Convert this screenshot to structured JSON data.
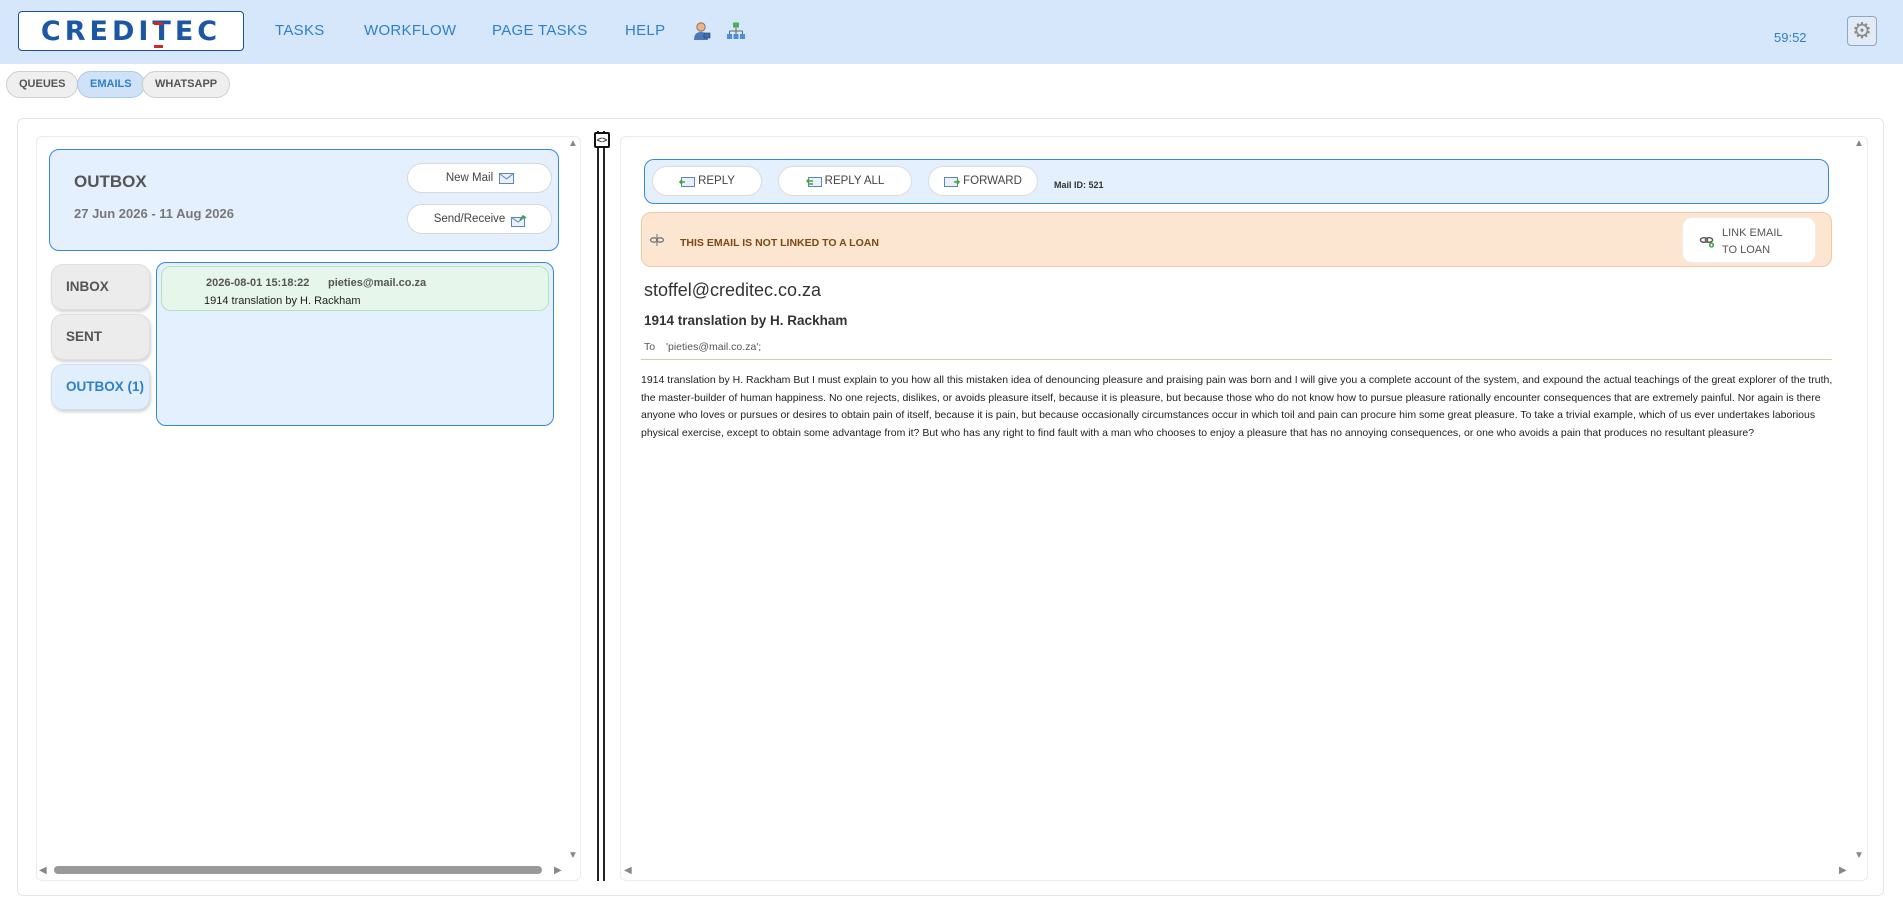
{
  "header": {
    "logo_text": "CREDITEC",
    "nav": [
      "TASKS",
      "WORKFLOW",
      "PAGE TASKS",
      "HELP"
    ],
    "timer": "59:52",
    "icons": [
      "user-icon",
      "org-chart-icon",
      "gear-icon"
    ]
  },
  "tabs": [
    {
      "label": "QUEUES",
      "active": false
    },
    {
      "label": "EMAILS",
      "active": true
    },
    {
      "label": "WHATSAPP",
      "active": false
    }
  ],
  "outbox": {
    "title": "OUTBOX",
    "date_range": "27 Jun 2026 - 11 Aug 2026",
    "new_mail_label": "New Mail",
    "send_receive_label": "Send/Receive"
  },
  "folders": [
    {
      "label": "INBOX",
      "active": false
    },
    {
      "label": "SENT",
      "active": false
    },
    {
      "label": "OUTBOX (1)",
      "active": true
    }
  ],
  "mail_list": [
    {
      "date": "2026-08-01 15:18:22",
      "from": "pieties@mail.co.za",
      "subject": "1914 translation by H. Rackham"
    }
  ],
  "actions": {
    "reply": "REPLY",
    "reply_all": "REPLY ALL",
    "forward": "FORWARD",
    "mail_id": "Mail ID: 521"
  },
  "warning": {
    "text": "THIS EMAIL IS NOT LINKED TO A LOAN",
    "link_line1": "LINK EMAIL",
    "link_line2": "TO LOAN"
  },
  "email": {
    "from": "stoffel@creditec.co.za",
    "subject": "1914 translation by H. Rackham",
    "to_label": "To",
    "to_value": "'pieties@mail.co.za';",
    "body": "1914 translation by H. Rackham But I must explain to you how all this mistaken idea of denouncing pleasure and praising pain was born and I will give you a complete account of the system, and expound the actual teachings of the great explorer of the truth, the master-builder of human happiness. No one rejects, dislikes, or avoids pleasure itself, because it is pleasure, but because those who do not know how to pursue pleasure rationally encounter consequences that are extremely painful. Nor again is there anyone who loves or pursues or desires to obtain pain of itself, because it is pain, but because occasionally circumstances occur in which toil and pain can procure him some great pleasure. To take a trivial example, which of us ever undertakes laborious physical exercise, except to obtain some advantage from it? But who has any right to find fault with a man who chooses to enjoy a pleasure that has no annoying consequences, or one who avoids a pain that produces no resultant pleasure?"
  },
  "colors": {
    "header_bg": "#d6e7fb",
    "accent": "#2f80c8",
    "panel_bg": "#e4f0fd",
    "warning_bg": "#fce5d1",
    "mail_item_bg": "#e6f6ea"
  }
}
